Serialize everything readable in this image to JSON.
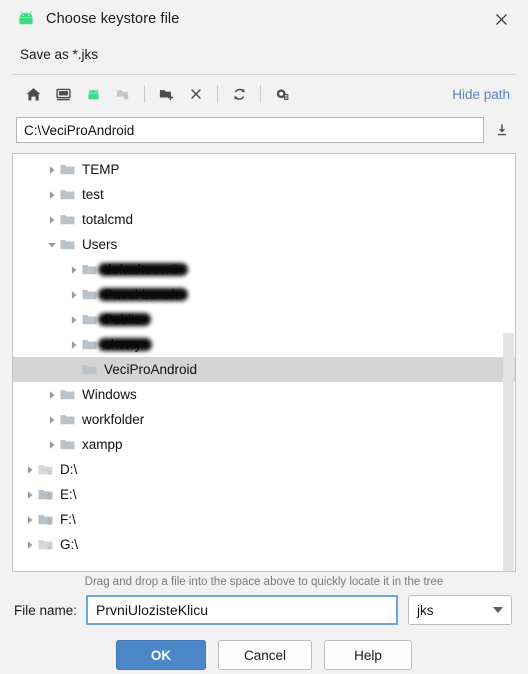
{
  "window": {
    "title": "Choose keystore file",
    "icon": "android-icon",
    "close_label": "×",
    "subtitle": "Save as *.jks"
  },
  "toolbar": {
    "buttons": [
      {
        "name": "home-icon",
        "tooltip": "Home",
        "disabled": false
      },
      {
        "name": "desktop-icon",
        "tooltip": "Desktop",
        "disabled": false
      },
      {
        "name": "android-icon",
        "tooltip": "Android",
        "disabled": false
      },
      {
        "name": "project-folder-icon",
        "tooltip": "Project",
        "disabled": true
      },
      {
        "name": "new-folder-icon",
        "tooltip": "New Folder",
        "disabled": false
      },
      {
        "name": "delete-icon",
        "tooltip": "Delete",
        "disabled": false
      },
      {
        "name": "refresh-icon",
        "tooltip": "Refresh",
        "disabled": false
      },
      {
        "name": "show-hidden-icon",
        "tooltip": "Show hidden files",
        "disabled": false
      }
    ],
    "hide_path_label": "Hide path"
  },
  "path": {
    "value": "C:\\VeciProAndroid",
    "placeholder": "",
    "download_icon": "download-icon"
  },
  "tree": {
    "rows": [
      {
        "label": "TEMP",
        "indent": 1,
        "twisty": "collapsed",
        "icon": "folder-icon",
        "selected": false,
        "redacted": false
      },
      {
        "label": "test",
        "indent": 1,
        "twisty": "collapsed",
        "icon": "folder-icon",
        "selected": false,
        "redacted": false
      },
      {
        "label": "totalcmd",
        "indent": 1,
        "twisty": "collapsed",
        "icon": "folder-icon",
        "selected": false,
        "redacted": false
      },
      {
        "label": "Users",
        "indent": 1,
        "twisty": "expanded",
        "icon": "folder-icon",
        "selected": false,
        "redacted": false
      },
      {
        "label": "defaultuser0",
        "indent": 2,
        "twisty": "collapsed",
        "icon": "folder-icon",
        "selected": false,
        "redacted": true
      },
      {
        "label": "Pavel Lunak",
        "indent": 2,
        "twisty": "collapsed",
        "icon": "folder-icon",
        "selected": false,
        "redacted": true
      },
      {
        "label": "Public",
        "indent": 2,
        "twisty": "collapsed",
        "icon": "folder-icon",
        "selected": false,
        "redacted": true
      },
      {
        "label": "sherry",
        "indent": 2,
        "twisty": "collapsed",
        "icon": "folder-icon",
        "selected": false,
        "redacted": true
      },
      {
        "label": "VeciProAndroid",
        "indent": 2,
        "twisty": "none",
        "icon": "folder-icon",
        "selected": true,
        "redacted": false
      },
      {
        "label": "Windows",
        "indent": 1,
        "twisty": "collapsed",
        "icon": "folder-icon",
        "selected": false,
        "redacted": false
      },
      {
        "label": "workfolder",
        "indent": 1,
        "twisty": "collapsed",
        "icon": "folder-icon",
        "selected": false,
        "redacted": false
      },
      {
        "label": "xampp",
        "indent": 1,
        "twisty": "collapsed",
        "icon": "folder-icon",
        "selected": false,
        "redacted": false
      },
      {
        "label": "D:\\",
        "indent": 0,
        "twisty": "collapsed",
        "icon": "drive-icon-light",
        "selected": false,
        "redacted": false
      },
      {
        "label": "E:\\",
        "indent": 0,
        "twisty": "collapsed",
        "icon": "drive-icon",
        "selected": false,
        "redacted": false
      },
      {
        "label": "F:\\",
        "indent": 0,
        "twisty": "collapsed",
        "icon": "drive-icon",
        "selected": false,
        "redacted": false
      },
      {
        "label": "G:\\",
        "indent": 0,
        "twisty": "collapsed",
        "icon": "drive-icon-light",
        "selected": false,
        "redacted": false
      }
    ],
    "scrollbar": {
      "thumb_top_pct": 43,
      "thumb_height_pct": 57
    }
  },
  "hint": "Drag and drop a file into the space above to quickly locate it in the tree",
  "filename": {
    "label": "File name:",
    "value": "PrvniUlozisteKlicu",
    "placeholder": ""
  },
  "extension": {
    "value": "jks",
    "options": [
      "jks"
    ]
  },
  "buttons": {
    "ok": "OK",
    "cancel": "Cancel",
    "help": "Help"
  },
  "colors": {
    "accent": "#4a86c8",
    "link": "#5a82c8",
    "android_green": "#3ddc84",
    "selection": "#d4d4d4",
    "window_bg": "#f2f2f2",
    "focus_border": "#6aa4dd"
  }
}
